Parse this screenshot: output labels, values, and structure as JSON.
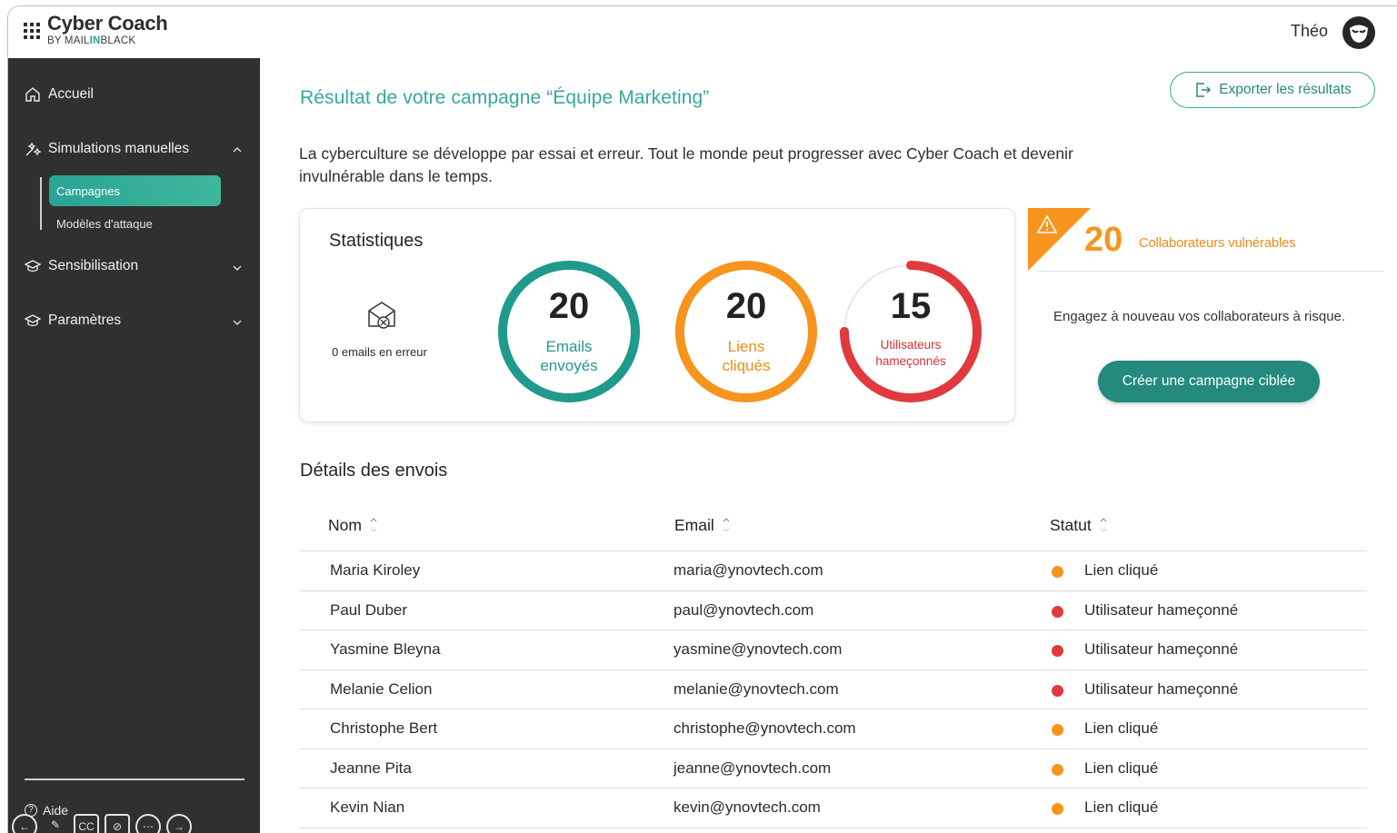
{
  "header": {
    "brand_name": "Cyber Coach",
    "brand_sub_prefix": "BY MAIL",
    "brand_sub_accent": "IN",
    "brand_sub_suffix": "BLACK",
    "username": "Théo"
  },
  "sidebar": {
    "home": "Accueil",
    "simulations": "Simulations manuelles",
    "campaigns": "Campagnes",
    "attack_models": "Modèles d'attaque",
    "awareness": "Sensibilisation",
    "settings": "Paramètres",
    "help": "Aide"
  },
  "main": {
    "title": "Résultat de votre campagne “Équipe Marketing”",
    "export_label": "Exporter les résultats",
    "intro": "La cyberculture se développe par essai et erreur. Tout le monde peut progresser avec Cyber Coach et devenir invulnérable dans le temps."
  },
  "stats": {
    "title": "Statistiques",
    "errors_label": "0 emails en erreur",
    "sent": {
      "value": "20",
      "label_1": "Emails",
      "label_2": "envoyés",
      "fraction": 1.0,
      "color": "#1f9a8c"
    },
    "clicked": {
      "value": "20",
      "label_1": "Liens",
      "label_2": "cliqués",
      "fraction": 1.0,
      "color": "#f7941d"
    },
    "phished": {
      "value": "15",
      "label_1": "Utilisateurs",
      "label_2": "hameçonnés",
      "fraction": 0.75,
      "color": "#e03a3e"
    }
  },
  "vulnerable": {
    "count": "20",
    "label": "Collaborateurs vulnérables",
    "engage_text": "Engagez à nouveau vos collaborateurs à risque.",
    "cta_label": "Créer une campagne ciblée"
  },
  "details": {
    "title": "Détails des envois",
    "columns": [
      "Nom",
      "Email",
      "Statut"
    ],
    "rows": [
      {
        "name": "Maria Kiroley",
        "email": "maria@ynovtech.com",
        "status": "Lien cliqué",
        "status_color": "#f7941d"
      },
      {
        "name": "Paul Duber",
        "email": "paul@ynovtech.com",
        "status": "Utilisateur hameçonné",
        "status_color": "#e03a3e"
      },
      {
        "name": "Yasmine Bleyna",
        "email": "yasmine@ynovtech.com",
        "status": "Utilisateur hameçonné",
        "status_color": "#e03a3e"
      },
      {
        "name": "Melanie Celion",
        "email": "melanie@ynovtech.com",
        "status": "Utilisateur hameçonné",
        "status_color": "#e03a3e"
      },
      {
        "name": "Christophe Bert",
        "email": "christophe@ynovtech.com",
        "status": "Lien cliqué",
        "status_color": "#f7941d"
      },
      {
        "name": "Jeanne Pita",
        "email": "jeanne@ynovtech.com",
        "status": "Lien cliqué",
        "status_color": "#f7941d"
      },
      {
        "name": "Kevin Nian",
        "email": "kevin@ynovtech.com",
        "status": "Lien cliqué",
        "status_color": "#f7941d"
      }
    ]
  }
}
